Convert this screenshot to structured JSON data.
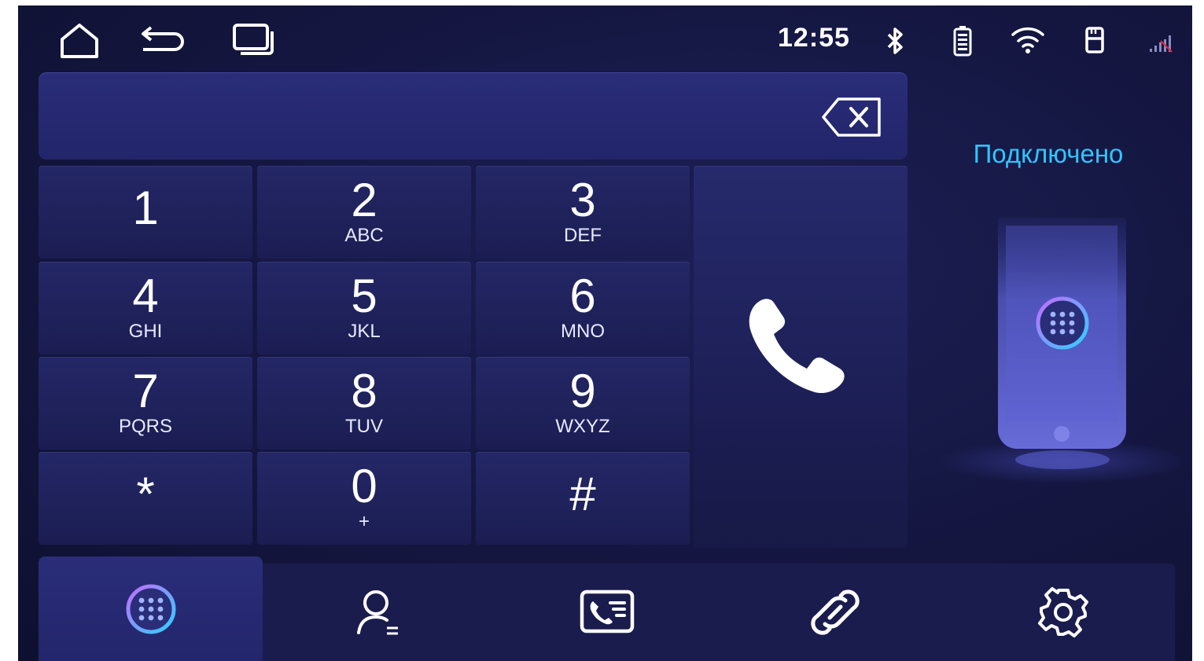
{
  "status_bar": {
    "time": "12:55",
    "icons": [
      "home-icon",
      "back-icon",
      "recent-apps-icon",
      "bluetooth-icon",
      "battery-icon",
      "wifi-icon",
      "sd-card-icon",
      "signal-icon"
    ]
  },
  "dialer": {
    "input_value": "",
    "keys": [
      {
        "digit": "1",
        "letters": ""
      },
      {
        "digit": "2",
        "letters": "ABC"
      },
      {
        "digit": "3",
        "letters": "DEF"
      },
      {
        "digit": "4",
        "letters": "GHI"
      },
      {
        "digit": "5",
        "letters": "JKL"
      },
      {
        "digit": "6",
        "letters": "MNO"
      },
      {
        "digit": "7",
        "letters": "PQRS"
      },
      {
        "digit": "8",
        "letters": "TUV"
      },
      {
        "digit": "9",
        "letters": "WXYZ"
      },
      {
        "digit": "*",
        "letters": ""
      },
      {
        "digit": "0",
        "letters": "+"
      },
      {
        "digit": "#",
        "letters": ""
      }
    ]
  },
  "connection": {
    "status": "Подключено"
  },
  "bottom_nav": {
    "tabs": [
      "keypad-icon",
      "contacts-icon",
      "call-log-icon",
      "link-icon",
      "settings-icon"
    ],
    "active": "keypad-icon"
  },
  "colors": {
    "accent": "#2fc6ff",
    "background": "#141640",
    "key": "#1f2259"
  }
}
